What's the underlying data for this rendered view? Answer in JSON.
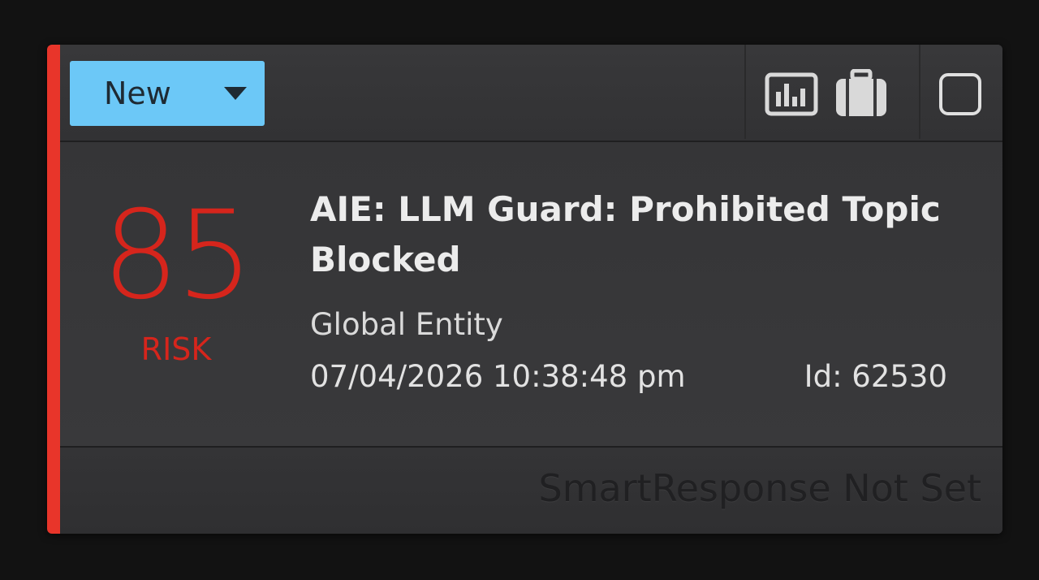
{
  "header": {
    "status_label": "New",
    "icons": [
      "analyze-chart-icon",
      "case-briefcase-icon",
      "select-checkbox-icon"
    ]
  },
  "alarm": {
    "risk_score": "85",
    "risk_label": "RISK",
    "title": "AIE: LLM Guard: Prohibited Topic Blocked",
    "entity": "Global Entity",
    "datetime": "07/04/2026 10:38:48 pm",
    "id_text": "Id: 62530"
  },
  "footer": {
    "smartresponse": "SmartResponse Not Set"
  },
  "colors": {
    "accent": "#e8352a",
    "risk": "#d6251c",
    "status_new": "#6cc8f7"
  }
}
